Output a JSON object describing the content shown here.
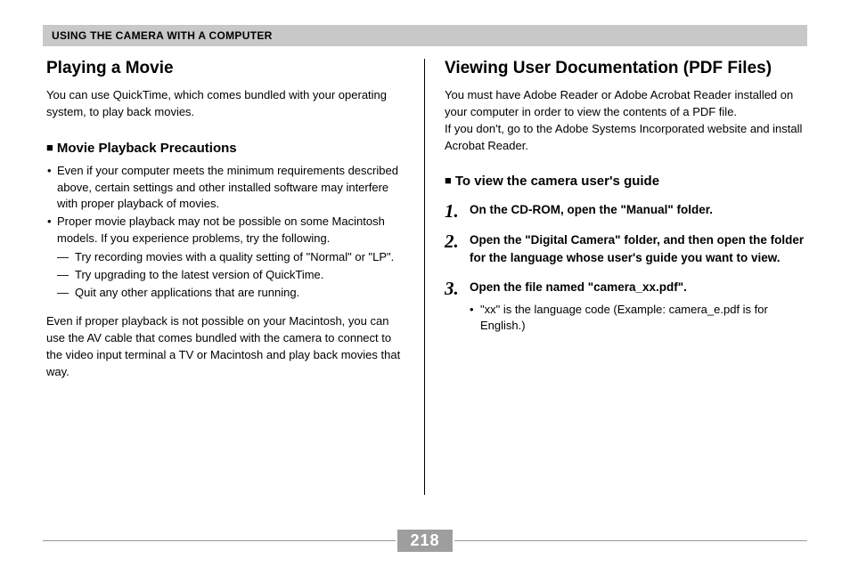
{
  "header": "USING THE CAMERA WITH A COMPUTER",
  "left": {
    "title": "Playing a Movie",
    "intro": "You can use QuickTime, which comes bundled with your operating system, to play back movies.",
    "subhead": "Movie Playback Precautions",
    "bullets": [
      {
        "text": "Even if your computer meets the minimum requirements described above, certain settings and other installed software may interfere with proper playback of movies."
      },
      {
        "text": "Proper movie playback may not be possible on some Macintosh models. If you experience problems, try the following.",
        "dashes": [
          "Try recording movies with a quality setting of \"Normal\" or \"LP\".",
          "Try upgrading to the latest version of QuickTime.",
          "Quit any other applications that are running."
        ]
      }
    ],
    "closing": "Even if proper playback is not possible on your Macintosh, you can use the AV cable that comes bundled with the camera to connect to the video input terminal a TV or Macintosh and play back movies that way."
  },
  "right": {
    "title": "Viewing User Documentation (PDF Files)",
    "intro1": "You must have Adobe Reader or Adobe Acrobat Reader installed on your computer in order to view the contents of a PDF file.",
    "intro2": "If you don't, go to the Adobe Systems Incorporated website and install Acrobat Reader.",
    "subhead": "To view the camera user's guide",
    "steps": [
      {
        "num": "1",
        "text": "On the CD-ROM, open the \"Manual\" folder."
      },
      {
        "num": "2",
        "text": "Open the \"Digital Camera\" folder, and then open the folder for the language whose user's guide you want to view."
      },
      {
        "num": "3",
        "text": "Open the file named \"camera_xx.pdf\".",
        "sub": [
          "\"xx\" is the language code (Example: camera_e.pdf is for English.)"
        ]
      }
    ]
  },
  "page_number": "218"
}
